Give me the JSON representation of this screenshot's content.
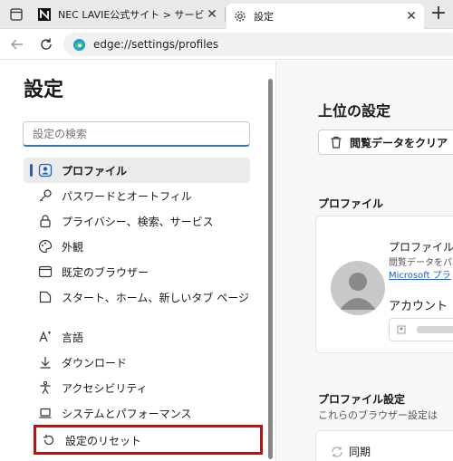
{
  "tabs": [
    {
      "title": "NEC LAVIE公式サイト > サービス＆サ",
      "icon": "nec-logo-icon",
      "active": false
    },
    {
      "title": "設定",
      "icon": "gear-icon",
      "active": true
    }
  ],
  "address": {
    "url": "edge://settings/profiles"
  },
  "sidebar": {
    "title": "設定",
    "search_placeholder": "設定の検索",
    "items": [
      {
        "label": "プロファイル",
        "icon": "profile-icon",
        "selected": true
      },
      {
        "label": "パスワードとオートフィル",
        "icon": "key-icon"
      },
      {
        "label": "プライバシー、検索、サービス",
        "icon": "lock-icon"
      },
      {
        "label": "外観",
        "icon": "palette-icon"
      },
      {
        "label": "既定のブラウザー",
        "icon": "browser-icon"
      },
      {
        "label": "スタート、ホーム、新しいタブ ページ",
        "icon": "home-icon"
      },
      {
        "label": "言語",
        "icon": "language-icon"
      },
      {
        "label": "ダウンロード",
        "icon": "download-icon"
      },
      {
        "label": "アクセシビリティ",
        "icon": "accessibility-icon"
      },
      {
        "label": "システムとパフォーマンス",
        "icon": "laptop-icon"
      },
      {
        "label": "設定のリセット",
        "icon": "reset-icon",
        "highlighted": true
      }
    ]
  },
  "main": {
    "title": "上位の設定",
    "clear_button": "閲覧データをクリア",
    "profile_section": "プロファイル",
    "profile_name": "プロファイル",
    "profile_sub": "閲覧データをパ",
    "profile_link": "Microsoft プラ",
    "account_label": "アカウント",
    "profile_settings_section": "プロファイル設定",
    "profile_settings_sub": "これらのブラウザー設定は",
    "sync_label": "同期"
  },
  "colors": {
    "accent": "#1f5fbf",
    "highlight": "#e00000"
  }
}
